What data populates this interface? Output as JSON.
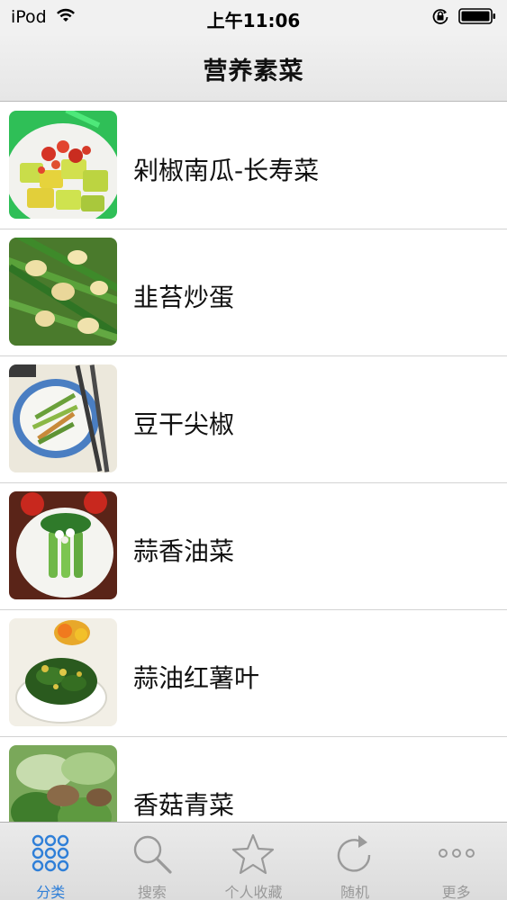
{
  "status_bar": {
    "carrier": "iPod",
    "time": "上午11:06",
    "icons": [
      "wifi-icon",
      "rotation-lock-icon",
      "battery-icon"
    ]
  },
  "nav": {
    "title": "营养素菜"
  },
  "recipes": [
    {
      "name": "剁椒南瓜-长寿菜"
    },
    {
      "name": "韭苔炒蛋"
    },
    {
      "name": "豆干尖椒"
    },
    {
      "name": "蒜香油菜"
    },
    {
      "name": "蒜油红薯叶"
    },
    {
      "name": "香菇青菜"
    }
  ],
  "tabs": [
    {
      "label": "分类",
      "icon": "grid-icon",
      "active": true
    },
    {
      "label": "搜索",
      "icon": "search-icon",
      "active": false
    },
    {
      "label": "个人收藏",
      "icon": "star-icon",
      "active": false
    },
    {
      "label": "随机",
      "icon": "refresh-icon",
      "active": false
    },
    {
      "label": "更多",
      "icon": "more-icon",
      "active": false
    }
  ],
  "colors": {
    "accent": "#2f7fd8",
    "inactive": "#999999"
  }
}
